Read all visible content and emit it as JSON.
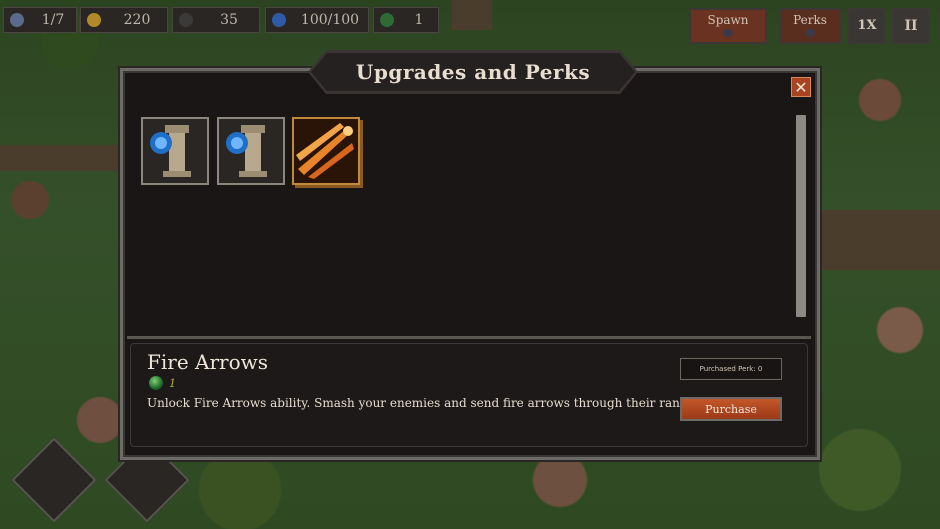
{
  "hud": {
    "wave": "1/7",
    "gold": "220",
    "kills": "35",
    "health": "100/100",
    "gems": "1"
  },
  "top_buttons": {
    "spawn": "Spawn",
    "perks": "Perks",
    "speed": "1X",
    "pause": "II"
  },
  "dialog": {
    "title": "Upgrades and Perks",
    "close": "✕"
  },
  "perk_slots": [
    {
      "icon": "tower-upgrade-icon"
    },
    {
      "icon": "tower-upgrade-icon"
    },
    {
      "icon": "fire-arrows-icon",
      "selected": true
    }
  ],
  "perk_detail": {
    "name": "Fire Arrows",
    "cost": "1",
    "description": "Unlock Fire Arrows ability. Smash your enemies and send fire arrows through their ranks!",
    "purchased_label": "Purchased Perk: 0",
    "purchase_button": "Purchase"
  },
  "colors": {
    "accent": "#a8441f",
    "panel": "#1a1616",
    "gold_text": "#b9ad3c"
  }
}
